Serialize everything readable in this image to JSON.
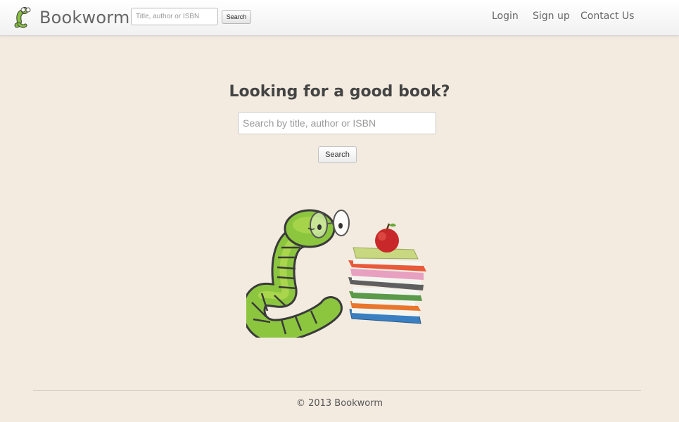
{
  "navbar": {
    "brand": "Bookworm",
    "search": {
      "placeholder": "Title, author or ISBN",
      "button_label": "Search"
    },
    "links": [
      {
        "label": "Login"
      },
      {
        "label": "Sign up"
      },
      {
        "label": "Contact Us"
      }
    ]
  },
  "main": {
    "headline": "Looking for a good book?",
    "search": {
      "placeholder": "Search by title, author or ISBN",
      "button_label": "Search"
    },
    "illustration": "bookworm-with-glasses-and-book-stack-with-apple-icon"
  },
  "footer": {
    "copyright": "© 2013 Bookworm"
  }
}
